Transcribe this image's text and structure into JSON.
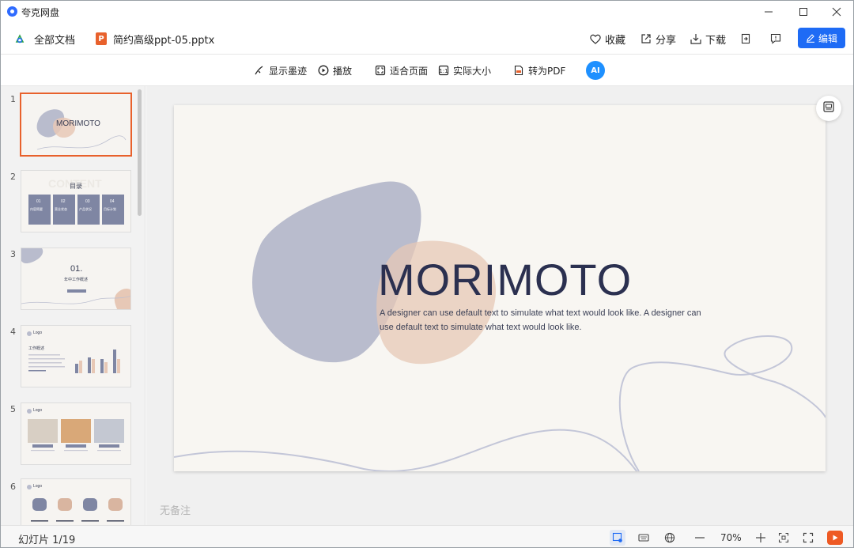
{
  "app": {
    "name": "夸克网盘"
  },
  "window_controls": {
    "minimize": "—",
    "maximize": "☐",
    "close": "✕"
  },
  "header": {
    "breadcrumb_root": "全部文档",
    "file_badge": "P",
    "file_name": "简约高级ppt-05.pptx",
    "actions": {
      "favorite": "收藏",
      "share": "分享",
      "download": "下载",
      "edit": "编辑"
    }
  },
  "toolbar": {
    "show_ink": "显示墨迹",
    "play": "播放",
    "fit_page": "适合页面",
    "actual_size": "实际大小",
    "to_pdf": "转为PDF",
    "ai": "AI"
  },
  "thumbnails": [
    {
      "num": "1",
      "title": "MORIMOTO"
    },
    {
      "num": "2",
      "title": "目录",
      "watermark": "CONTENT",
      "items": [
        "01",
        "02",
        "03",
        "04"
      ],
      "item_labels": [
        "内容简要",
        "营业状态",
        "产品状况",
        "目标计划"
      ]
    },
    {
      "num": "3",
      "big": "01.",
      "sub": "年中工作概述"
    },
    {
      "num": "4",
      "logo": "Logo",
      "heading": "工作概述"
    },
    {
      "num": "5",
      "logo": "Logo"
    },
    {
      "num": "6",
      "logo": "Logo"
    }
  ],
  "slide": {
    "title": "MORIMOTO",
    "body": "A designer can use default text to simulate what text would look like. A designer can use default text to simulate what text would look like."
  },
  "notes_placeholder": "无备注",
  "status": {
    "slide_counter": "幻灯片 1/19",
    "zoom": "70%"
  },
  "colors": {
    "accent": "#1e6bf5",
    "active_thumb": "#e8612c",
    "blob_blue": "#b9bccd",
    "blob_peach": "#e7c8b6",
    "title_color": "#2b3050"
  }
}
